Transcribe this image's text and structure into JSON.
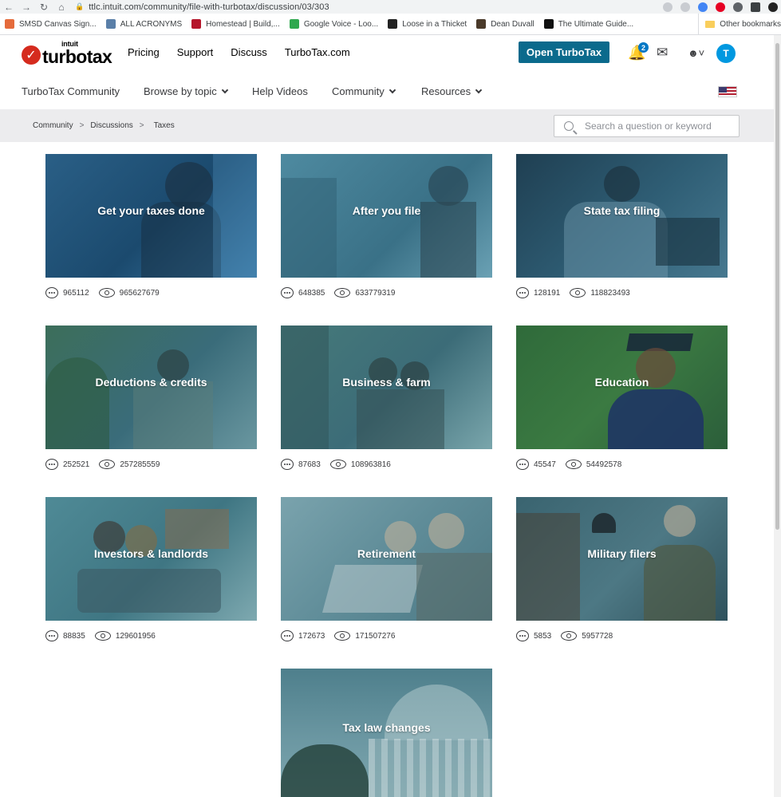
{
  "browser": {
    "url": "ttlc.intuit.com/community/file-with-turbotax/discussion/03/303",
    "bookmarks": [
      {
        "label": "SMSD Canvas Sign...",
        "color": "#e56b3c"
      },
      {
        "label": "ALL ACRONYMS",
        "color": "#5a7fa8"
      },
      {
        "label": "Homestead | Build,...",
        "color": "#b5162b"
      },
      {
        "label": "Google Voice - Loo...",
        "color": "#2fa84f"
      },
      {
        "label": "Loose in a Thicket",
        "color": "#222222"
      },
      {
        "label": "Dean Duvall",
        "color": "#4a3a2a"
      },
      {
        "label": "The Ultimate Guide...",
        "color": "#111111"
      }
    ],
    "more_bookmarks": "»",
    "other_bookmarks": "Other bookmarks"
  },
  "header": {
    "logo_top": "intuit",
    "logo_main": "turbotax",
    "nav": [
      "Pricing",
      "Support",
      "Discuss",
      "TurboTax.com"
    ],
    "cta": "Open TurboTax",
    "notification_count": "2",
    "avatar_initial": "T"
  },
  "community_nav": {
    "brand": "TurboTax Community",
    "items": [
      "Browse by topic",
      "Help Videos",
      "Community",
      "Resources"
    ]
  },
  "breadcrumb": [
    "Community",
    "Discussions",
    "Taxes"
  ],
  "breadcrumb_sep": ">",
  "search": {
    "placeholder": "Search a question or keyword"
  },
  "cards": [
    {
      "title": "Get your taxes done",
      "replies": "965112",
      "views": "965627679"
    },
    {
      "title": "After you file",
      "replies": "648385",
      "views": "633779319"
    },
    {
      "title": "State tax filing",
      "replies": "128191",
      "views": "118823493"
    },
    {
      "title": "Deductions & credits",
      "replies": "252521",
      "views": "257285559"
    },
    {
      "title": "Business & farm",
      "replies": "87683",
      "views": "108963816"
    },
    {
      "title": "Education",
      "replies": "45547",
      "views": "54492578"
    },
    {
      "title": "Investors & landlords",
      "replies": "88835",
      "views": "129601956"
    },
    {
      "title": "Retirement",
      "replies": "172673",
      "views": "171507276"
    },
    {
      "title": "Military filers",
      "replies": "5853",
      "views": "5957728"
    },
    {
      "title": "Tax law changes",
      "replies": "",
      "views": ""
    }
  ],
  "colors": {
    "brand_red": "#d52b1e",
    "cta": "#0b6a8c",
    "badge": "#0077c5"
  }
}
